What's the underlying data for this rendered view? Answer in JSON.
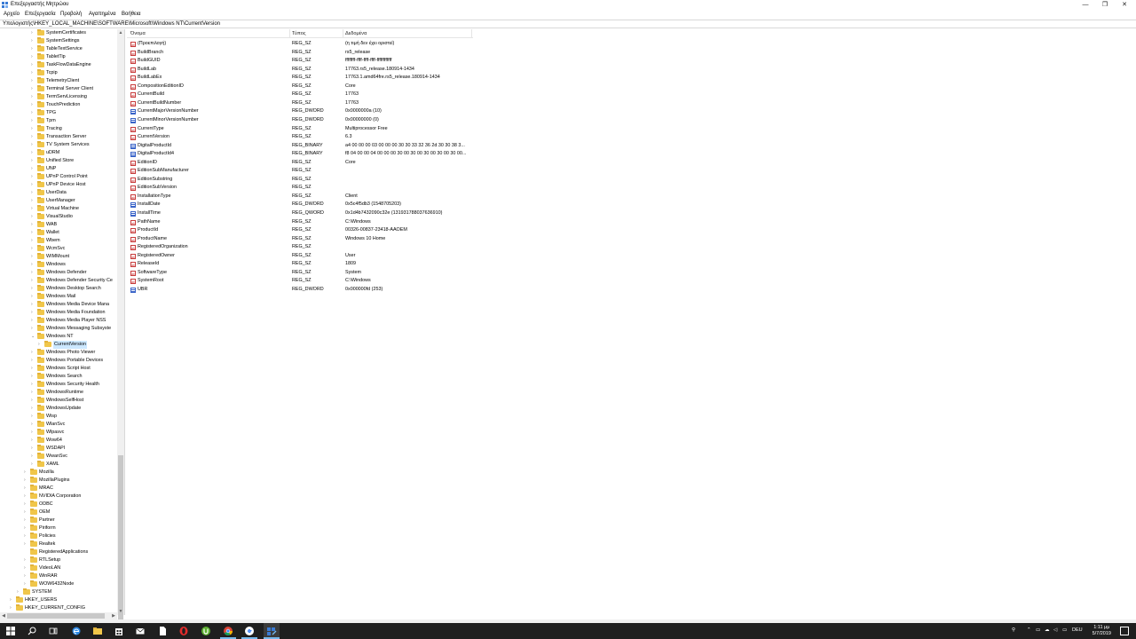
{
  "window": {
    "title": "Επεξεργαστής Μητρώου",
    "minimize": "—",
    "maximize": "❐",
    "close": "✕"
  },
  "menu": [
    "Αρχείο",
    "Επεξεργασία",
    "Προβολή",
    "Αγαπημένα",
    "Βοήθεια"
  ],
  "address": "Υπολογιστής\\HKEY_LOCAL_MACHINE\\SOFTWARE\\Microsoft\\Windows NT\\CurrentVersion",
  "tree": [
    {
      "label": "SystemCertificates",
      "level": 3,
      "expander": true
    },
    {
      "label": "SystemSettings",
      "level": 3,
      "expander": true
    },
    {
      "label": "TableTextService",
      "level": 3,
      "expander": true
    },
    {
      "label": "TabletTip",
      "level": 3,
      "expander": true
    },
    {
      "label": "TaskFlowDataEngine",
      "level": 3,
      "expander": true
    },
    {
      "label": "Tcpip",
      "level": 3,
      "expander": true
    },
    {
      "label": "TelemetryClient",
      "level": 3,
      "expander": true
    },
    {
      "label": "Terminal Server Client",
      "level": 3,
      "expander": true
    },
    {
      "label": "TermServLicensing",
      "level": 3,
      "expander": true
    },
    {
      "label": "TouchPrediction",
      "level": 3,
      "expander": true
    },
    {
      "label": "TPG",
      "level": 3,
      "expander": true
    },
    {
      "label": "Tpm",
      "level": 3,
      "expander": true
    },
    {
      "label": "Tracing",
      "level": 3,
      "expander": true
    },
    {
      "label": "Transaction Server",
      "level": 3,
      "expander": true
    },
    {
      "label": "TV System Services",
      "level": 3,
      "expander": true
    },
    {
      "label": "uDRM",
      "level": 3,
      "expander": true
    },
    {
      "label": "Unified Store",
      "level": 3,
      "expander": true
    },
    {
      "label": "UNP",
      "level": 3,
      "expander": true
    },
    {
      "label": "UPnP Control Point",
      "level": 3,
      "expander": true
    },
    {
      "label": "UPnP Device Host",
      "level": 3,
      "expander": true
    },
    {
      "label": "UserData",
      "level": 3,
      "expander": true
    },
    {
      "label": "UserManager",
      "level": 3,
      "expander": true
    },
    {
      "label": "Virtual Machine",
      "level": 3,
      "expander": true
    },
    {
      "label": "VisualStudio",
      "level": 3,
      "expander": true
    },
    {
      "label": "WAB",
      "level": 3,
      "expander": true
    },
    {
      "label": "Wallet",
      "level": 3,
      "expander": true
    },
    {
      "label": "Wbem",
      "level": 3,
      "expander": true
    },
    {
      "label": "WcmSvc",
      "level": 3,
      "expander": true
    },
    {
      "label": "WIMMount",
      "level": 3,
      "expander": true
    },
    {
      "label": "Windows",
      "level": 3,
      "expander": true
    },
    {
      "label": "Windows Defender",
      "level": 3,
      "expander": true
    },
    {
      "label": "Windows Defender Security Ce",
      "level": 3,
      "expander": true
    },
    {
      "label": "Windows Desktop Search",
      "level": 3,
      "expander": true
    },
    {
      "label": "Windows Mail",
      "level": 3,
      "expander": true
    },
    {
      "label": "Windows Media Device Mana",
      "level": 3,
      "expander": true
    },
    {
      "label": "Windows Media Foundation",
      "level": 3,
      "expander": true
    },
    {
      "label": "Windows Media Player NSS",
      "level": 3,
      "expander": true
    },
    {
      "label": "Windows Messaging Subsyste",
      "level": 3,
      "expander": true
    },
    {
      "label": "Windows NT",
      "level": 3,
      "expander": true,
      "expanded": true
    },
    {
      "label": "CurrentVersion",
      "level": 4,
      "expander": true,
      "selected": true
    },
    {
      "label": "Windows Photo Viewer",
      "level": 3,
      "expander": true
    },
    {
      "label": "Windows Portable Devices",
      "level": 3,
      "expander": true
    },
    {
      "label": "Windows Script Host",
      "level": 3,
      "expander": true
    },
    {
      "label": "Windows Search",
      "level": 3,
      "expander": true
    },
    {
      "label": "Windows Security Health",
      "level": 3,
      "expander": true
    },
    {
      "label": "WindowsRuntime",
      "level": 3,
      "expander": true
    },
    {
      "label": "WindowsSelfHost",
      "level": 3,
      "expander": true
    },
    {
      "label": "WindowsUpdate",
      "level": 3,
      "expander": true
    },
    {
      "label": "Wisp",
      "level": 3,
      "expander": true
    },
    {
      "label": "WlanSvc",
      "level": 3,
      "expander": true
    },
    {
      "label": "Wlpasvc",
      "level": 3,
      "expander": true
    },
    {
      "label": "Wow64",
      "level": 3,
      "expander": true
    },
    {
      "label": "WSDAPI",
      "level": 3,
      "expander": true
    },
    {
      "label": "WwanSvc",
      "level": 3,
      "expander": true
    },
    {
      "label": "XAML",
      "level": 3,
      "expander": true
    },
    {
      "label": "Mozilla",
      "level": 2,
      "expander": true
    },
    {
      "label": "MozillaPlugins",
      "level": 2,
      "expander": true
    },
    {
      "label": "MRAC",
      "level": 2,
      "expander": true
    },
    {
      "label": "NVIDIA Corporation",
      "level": 2,
      "expander": true
    },
    {
      "label": "ODBC",
      "level": 2,
      "expander": true
    },
    {
      "label": "OEM",
      "level": 2,
      "expander": true
    },
    {
      "label": "Partner",
      "level": 2,
      "expander": true
    },
    {
      "label": "Piriform",
      "level": 2,
      "expander": true
    },
    {
      "label": "Policies",
      "level": 2,
      "expander": true
    },
    {
      "label": "Realtek",
      "level": 2,
      "expander": true
    },
    {
      "label": "RegisteredApplications",
      "level": 2,
      "expander": false
    },
    {
      "label": "RTLSetup",
      "level": 2,
      "expander": true
    },
    {
      "label": "VideoLAN",
      "level": 2,
      "expander": true
    },
    {
      "label": "WinRAR",
      "level": 2,
      "expander": true
    },
    {
      "label": "WOW6432Node",
      "level": 2,
      "expander": true
    },
    {
      "label": "SYSTEM",
      "level": 1,
      "expander": true
    },
    {
      "label": "HKEY_USERS",
      "level": 0,
      "expander": true
    },
    {
      "label": "HKEY_CURRENT_CONFIG",
      "level": 0,
      "expander": true
    }
  ],
  "columns": {
    "name": "Όνομα",
    "type": "Τύπος",
    "data": "Δεδομένα"
  },
  "values": [
    {
      "name": "(Προεπιλογή)",
      "type": "REG_SZ",
      "data": "(η τιμή δεν έχει οριστεί)",
      "kind": "sz"
    },
    {
      "name": "BuildBranch",
      "type": "REG_SZ",
      "data": "rs5_release",
      "kind": "sz"
    },
    {
      "name": "BuildGUID",
      "type": "REG_SZ",
      "data": "ffffffff-ffff-ffff-ffff-ffffffffffff",
      "kind": "sz"
    },
    {
      "name": "BuildLab",
      "type": "REG_SZ",
      "data": "17763.rs5_release.180914-1434",
      "kind": "sz"
    },
    {
      "name": "BuildLabEx",
      "type": "REG_SZ",
      "data": "17763.1.amd64fre.rs5_release.180914-1434",
      "kind": "sz"
    },
    {
      "name": "CompositionEditionID",
      "type": "REG_SZ",
      "data": "Core",
      "kind": "sz"
    },
    {
      "name": "CurrentBuild",
      "type": "REG_SZ",
      "data": "17763",
      "kind": "sz"
    },
    {
      "name": "CurrentBuildNumber",
      "type": "REG_SZ",
      "data": "17763",
      "kind": "sz"
    },
    {
      "name": "CurrentMajorVersionNumber",
      "type": "REG_DWORD",
      "data": "0x0000000a (10)",
      "kind": "bin"
    },
    {
      "name": "CurrentMinorVersionNumber",
      "type": "REG_DWORD",
      "data": "0x00000000 (0)",
      "kind": "bin"
    },
    {
      "name": "CurrentType",
      "type": "REG_SZ",
      "data": "Multiprocessor Free",
      "kind": "sz"
    },
    {
      "name": "CurrentVersion",
      "type": "REG_SZ",
      "data": "6.3",
      "kind": "sz"
    },
    {
      "name": "DigitalProductId",
      "type": "REG_BINARY",
      "data": "a4 00 00 00 03 00 00 00 30 30 33 32 36 2d 30 30 38 3...",
      "kind": "bin"
    },
    {
      "name": "DigitalProductId4",
      "type": "REG_BINARY",
      "data": "f8 04 00 00 04 00 00 00 30 00 30 00 30 00 30 00 30 00...",
      "kind": "bin"
    },
    {
      "name": "EditionID",
      "type": "REG_SZ",
      "data": "Core",
      "kind": "sz"
    },
    {
      "name": "EditionSubManufacturer",
      "type": "REG_SZ",
      "data": "",
      "kind": "sz"
    },
    {
      "name": "EditionSubstring",
      "type": "REG_SZ",
      "data": "",
      "kind": "sz"
    },
    {
      "name": "EditionSubVersion",
      "type": "REG_SZ",
      "data": "",
      "kind": "sz"
    },
    {
      "name": "InstallationType",
      "type": "REG_SZ",
      "data": "Client",
      "kind": "sz"
    },
    {
      "name": "InstallDate",
      "type": "REG_DWORD",
      "data": "0x5c4f5db3 (1548705203)",
      "kind": "bin"
    },
    {
      "name": "InstallTime",
      "type": "REG_QWORD",
      "data": "0x1d4b7432090c32e (131931788037636910)",
      "kind": "bin"
    },
    {
      "name": "PathName",
      "type": "REG_SZ",
      "data": "C:\\Windows",
      "kind": "sz"
    },
    {
      "name": "ProductId",
      "type": "REG_SZ",
      "data": "00326-00837-23418-AAOEM",
      "kind": "sz"
    },
    {
      "name": "ProductName",
      "type": "REG_SZ",
      "data": "Windows 10 Home",
      "kind": "sz"
    },
    {
      "name": "RegisteredOrganization",
      "type": "REG_SZ",
      "data": "",
      "kind": "sz"
    },
    {
      "name": "RegisteredOwner",
      "type": "REG_SZ",
      "data": "User",
      "kind": "sz"
    },
    {
      "name": "ReleaseId",
      "type": "REG_SZ",
      "data": "1809",
      "kind": "sz"
    },
    {
      "name": "SoftwareType",
      "type": "REG_SZ",
      "data": "System",
      "kind": "sz"
    },
    {
      "name": "SystemRoot",
      "type": "REG_SZ",
      "data": "C:\\Windows",
      "kind": "sz"
    },
    {
      "name": "UBR",
      "type": "REG_DWORD",
      "data": "0x000000fd (253)",
      "kind": "bin"
    }
  ],
  "taskbar": {
    "apps": [
      "start-icon",
      "search-icon",
      "task-view-icon",
      "edge-icon",
      "file-explorer-icon",
      "store-icon",
      "mail-icon",
      "file-icon",
      "opera-icon",
      "utorrent-icon",
      "chrome-icon",
      "google-icon",
      "regedit-icon"
    ],
    "language": "DEU",
    "time": "1:11 μμ",
    "date": "5/7/2019"
  },
  "colors": {
    "selection": "#cce8ff",
    "folder": "#f0c64a",
    "taskbar": "#1f1f1f",
    "string_icon": "#c83c3c",
    "binary_icon": "#3a64c8"
  }
}
